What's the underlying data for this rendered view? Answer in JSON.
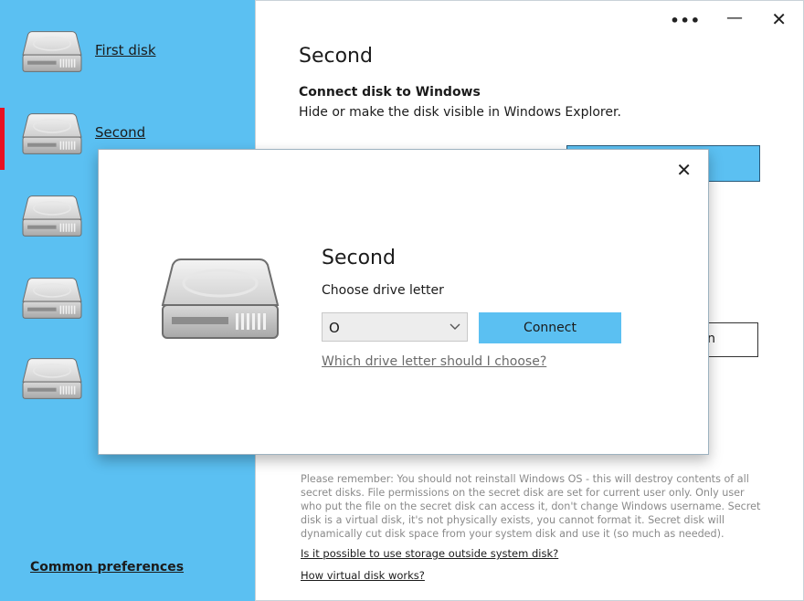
{
  "sidebar": {
    "items": [
      {
        "label": "First disk",
        "selected": false
      },
      {
        "label": "Second",
        "selected": true
      },
      {
        "label": "",
        "selected": false
      },
      {
        "label": "",
        "selected": false
      },
      {
        "label": "",
        "selected": false
      }
    ],
    "common_preferences": "Common preferences",
    "icon": "hard-disk-icon"
  },
  "window": {
    "more_icon": "•••",
    "minimize_icon": "—",
    "close_icon": "✕"
  },
  "main": {
    "title": "Second",
    "section_heading": "Connect disk to Windows",
    "section_desc": "Hide or make the disk visible in Windows Explorer.",
    "obscured_button_label": "n",
    "notice": "Please remember: You should not reinstall Windows OS - this will destroy contents of all secret disks. File permissions on the secret disk are set for current user only. Only user who put the file on the secret disk can access it, don't change Windows username. Secret disk is a virtual disk, it's not physically exists, you cannot format it. Secret disk will dynamically cut disk space from your system disk and use it (so much as needed).",
    "link_storage": "Is it possible to use storage outside system disk?",
    "link_how_works": "How virtual disk works?"
  },
  "dialog": {
    "close_icon": "✕",
    "title": "Second",
    "choose_label": "Choose drive letter",
    "selected_letter": "O",
    "connect_label": "Connect",
    "help_link": "Which drive letter should I choose?"
  },
  "colors": {
    "accent": "#5bc0f2",
    "selection_bar": "#e81123"
  }
}
